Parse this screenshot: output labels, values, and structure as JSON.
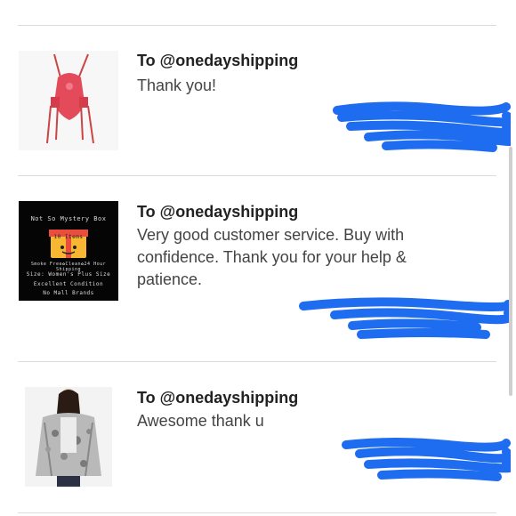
{
  "reviews": [
    {
      "to": "To @onedayshipping",
      "message": "Thank you!"
    },
    {
      "to": "To @onedayshipping",
      "message": "Very good customer service. Buy with confidence. Thank you for your help & patience."
    },
    {
      "to": "To @onedayshipping",
      "message": "Awesome thank u"
    }
  ],
  "mystery_box": {
    "title": "Not So Mystery Box",
    "count": "10 Items",
    "line1": "Smoke Free✿Clean✿24 Hour Shipping",
    "line2": "Size: Women's Plus Size",
    "line3": "Excellent Condition",
    "line4": "No Mall Brands"
  },
  "colors": {
    "redaction": "#1e6cf0",
    "divider": "#dcdcdc"
  }
}
